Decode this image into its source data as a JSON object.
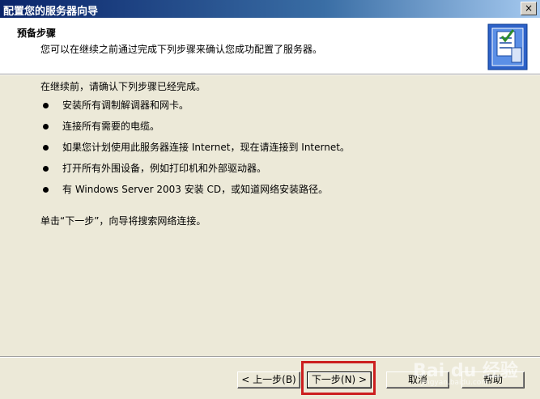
{
  "window": {
    "title": "配置您的服务器向导",
    "close_glyph": "×"
  },
  "header": {
    "title": "预备步骤",
    "subtitle": "您可以在继续之前通过完成下列步骤来确认您成功配置了服务器。",
    "icon": "server-checklist-icon"
  },
  "body": {
    "intro": "在继续前，请确认下列步骤已经完成。",
    "steps": [
      "安装所有调制解调器和网卡。",
      "连接所有需要的电缆。",
      "如果您计划使用此服务器连接 Internet，现在请连接到 Internet。",
      "打开所有外围设备，例如打印机和外部驱动器。",
      "有 Windows Server 2003 安装 CD，或知道网络安装路径。"
    ],
    "footer": "单击“下一步”，向导将搜索网络连接。"
  },
  "buttons": {
    "back": "< 上一步(B)",
    "next": "下一步(N) >",
    "cancel": "取消",
    "help": "帮助"
  },
  "watermark": {
    "text": "Bai du 经验",
    "sub": "jingyan.baidu.com"
  },
  "colors": {
    "titlebar_start": "#0a246a",
    "titlebar_end": "#a6caf0",
    "dialog_bg": "#ece9d8",
    "highlight": "#cc1f1f"
  }
}
